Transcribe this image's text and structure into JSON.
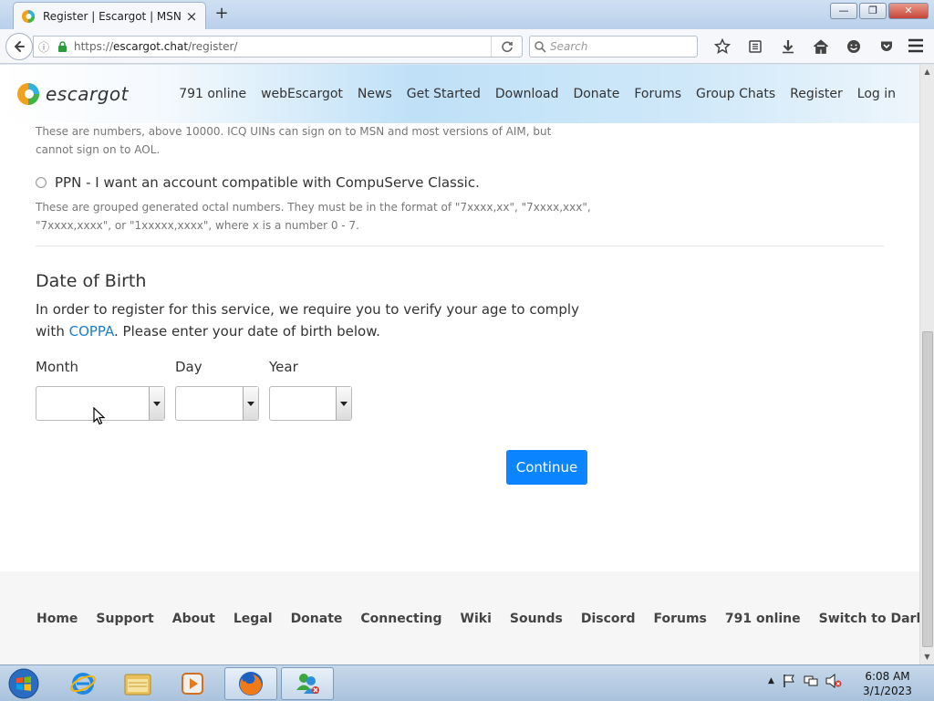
{
  "browser": {
    "tab_title": "Register | Escargot | MSN ...",
    "tab_close": "×",
    "new_tab": "+",
    "url_prefix": "https://",
    "url_host": "escargot.chat",
    "url_path": "/register/",
    "search_placeholder": "Search",
    "window_buttons": {
      "minimize": "—",
      "maximize": "❐",
      "close": "✕"
    }
  },
  "site": {
    "logo_text": "escargot",
    "nav": [
      "791 online",
      "webEscargot",
      "News",
      "Get Started",
      "Download",
      "Donate",
      "Forums",
      "Group Chats",
      "Register",
      "Log in"
    ]
  },
  "form": {
    "uin_help": "These are numbers, above 10000. ICQ UINs can sign on to MSN and most versions of AIM, but cannot sign on to AOL.",
    "ppn_label": "PPN - I want an account compatible with CompuServe Classic.",
    "ppn_help": "These are grouped generated octal numbers. They must be in the format of \"7xxxx,xx\", \"7xxxx,xxx\", \"7xxxx,xxxx\", or \"1xxxxx,xxxx\", where x is a number 0 - 7.",
    "dob_heading": "Date of Birth",
    "dob_text_before": "In order to register for this service, we require you to verify your age to comply with ",
    "dob_link": "COPPA",
    "dob_text_after": ". Please enter your date of birth below.",
    "month_label": "Month",
    "day_label": "Day",
    "year_label": "Year",
    "month_value": "",
    "day_value": "",
    "year_value": "",
    "continue_label": "Continue"
  },
  "footer": {
    "links": [
      "Home",
      "Support",
      "About",
      "Legal",
      "Donate",
      "Connecting",
      "Wiki",
      "Sounds",
      "Discord",
      "Forums",
      "791 online",
      "Switch to Dark Mode"
    ]
  },
  "taskbar": {
    "time": "6:08 AM",
    "date": "3/1/2023"
  }
}
